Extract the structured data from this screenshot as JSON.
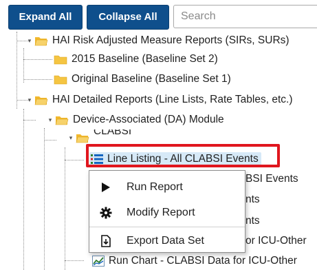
{
  "toolbar": {
    "expand_all_label": "Expand All",
    "collapse_all_label": "Collapse All",
    "search_placeholder": "Search"
  },
  "tree": {
    "nodes": [
      {
        "label": "HAI Risk Adjusted Measure Reports (SIRs, SURs)"
      },
      {
        "label": "2015 Baseline (Baseline Set 2)"
      },
      {
        "label": "Original Baseline (Baseline Set 1)"
      },
      {
        "label": "HAI Detailed Reports (Line Lists, Rate Tables, etc.)"
      },
      {
        "label": "Device-Associated (DA) Module"
      },
      {
        "label": "CLABSI"
      },
      {
        "label": "Line Listing - All CLABSI Events"
      },
      {
        "label": "BSI Events"
      },
      {
        "label": "nts"
      },
      {
        "label": "nts"
      },
      {
        "label": "or ICU-Other"
      },
      {
        "label": "Run Chart - CLABSI Data for ICU-Other"
      }
    ]
  },
  "context_menu": {
    "items": [
      {
        "label": "Run Report",
        "icon": "play-icon"
      },
      {
        "label": "Modify Report",
        "icon": "gear-icon"
      },
      {
        "label": "Export Data Set",
        "icon": "export-icon"
      }
    ]
  },
  "colors": {
    "button_bg": "#0f4f8c",
    "folder_yellow": "#f5c542",
    "highlight_red": "#e0161e",
    "selection_bg": "#d6e9f7"
  }
}
